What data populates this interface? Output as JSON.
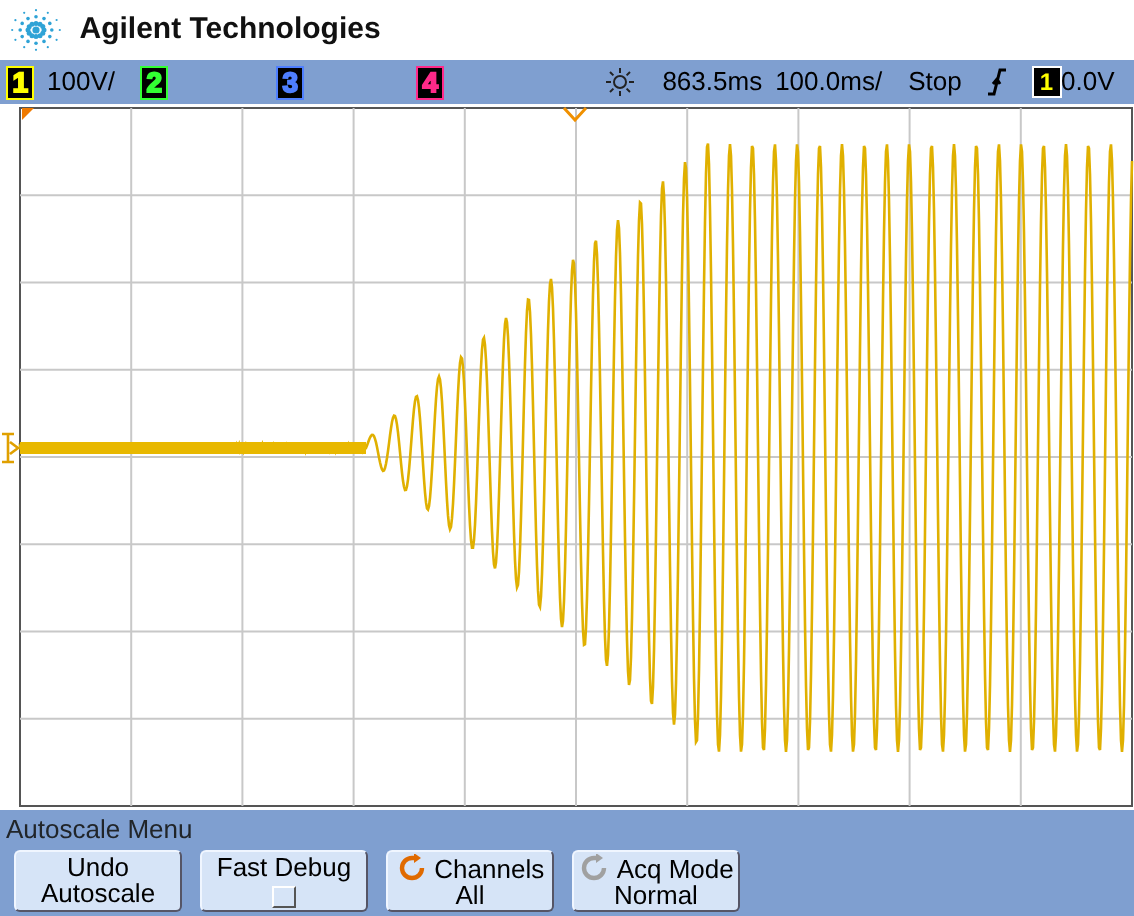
{
  "header": {
    "brand": "Agilent Technologies"
  },
  "status_bar": {
    "channels": [
      {
        "number": "1",
        "scale": "100V/",
        "color": "#ffff00"
      },
      {
        "number": "2",
        "color": "#33ff33"
      },
      {
        "number": "3",
        "color": "#4f7fff"
      },
      {
        "number": "4",
        "color": "#ff2a8a"
      }
    ],
    "delay": "863.5ms",
    "timebase": "100.0ms/",
    "run_state": "Stop",
    "trigger_source": "1",
    "trigger_level": "0.0V"
  },
  "menu": {
    "title": "Autoscale Menu",
    "softkeys": [
      {
        "kind": "plain",
        "lines": [
          "Undo",
          "Autoscale"
        ]
      },
      {
        "kind": "checkbox",
        "lines": [
          "Fast Debug"
        ],
        "checked": false
      },
      {
        "kind": "cycle",
        "lines": [
          "Channels",
          "All"
        ],
        "icon_active": true
      },
      {
        "kind": "cycle",
        "lines": [
          "Acq Mode",
          "Normal"
        ],
        "icon_active": false
      }
    ]
  }
}
